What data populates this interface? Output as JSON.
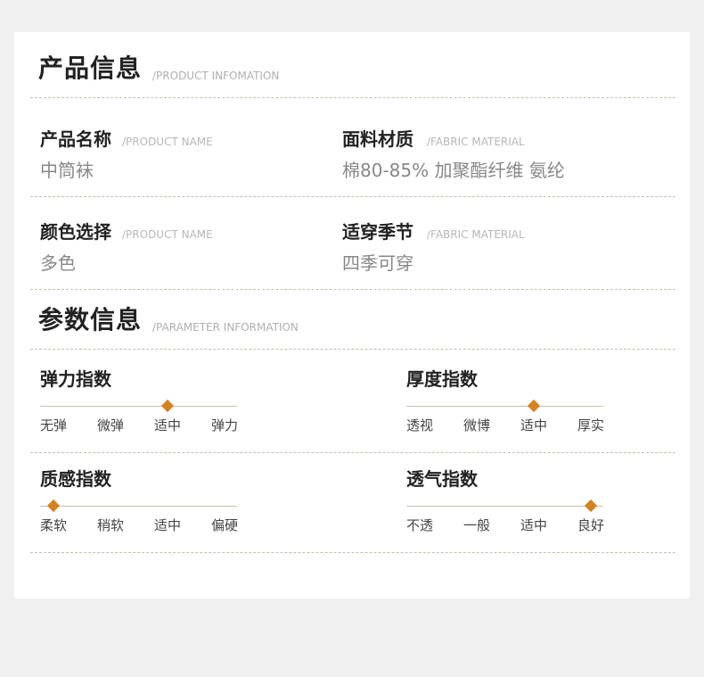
{
  "colors": {
    "accent": "#d4831f",
    "line": "#c9c2b3",
    "card": "#ffffff",
    "background": "#f0f0f0"
  },
  "product": {
    "title": "产品信息",
    "subtitle": "/PRODUCT INFOMATION",
    "fields": [
      {
        "label": "产品名称",
        "sub": "/PRODUCT NAME",
        "value": "中筒袜"
      },
      {
        "label": "面料材质",
        "sub": "/FABRIC MATERIAL",
        "value": "棉80-85% 加聚酯纤维 氨纶"
      },
      {
        "label": "颜色选择",
        "sub": "/PRODUCT NAME",
        "value": "多色"
      },
      {
        "label": "适穿季节",
        "sub": "/FABRIC MATERIAL",
        "value": "四季可穿"
      }
    ]
  },
  "params": {
    "title": "参数信息",
    "subtitle": "/PARAMETER INFORMATION",
    "items": [
      {
        "title": "弹力指数",
        "scale": [
          "无弹",
          "微弹",
          "适中",
          "弹力"
        ],
        "level": 2
      },
      {
        "title": "厚度指数",
        "scale": [
          "透视",
          "微博",
          "适中",
          "厚实"
        ],
        "level": 2
      },
      {
        "title": "质感指数",
        "scale": [
          "柔软",
          "稍软",
          "适中",
          "偏硬"
        ],
        "level": 0
      },
      {
        "title": "透气指数",
        "scale": [
          "不透",
          "一般",
          "适中",
          "良好"
        ],
        "level": 3
      }
    ]
  }
}
